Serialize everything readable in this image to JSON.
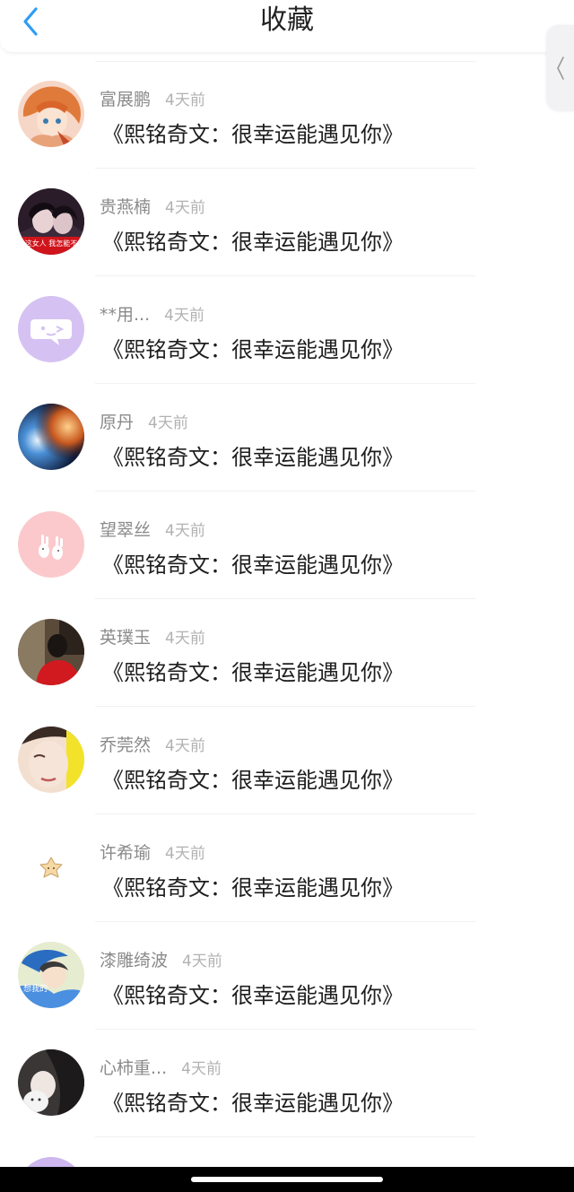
{
  "header": {
    "title": "收藏",
    "back_icon": "chevron-left-icon",
    "accent": "#2e9df5"
  },
  "side_tab": {
    "icon": "chevron-left-icon"
  },
  "items": [
    {
      "name": "富展鹏",
      "time": "4天前",
      "book": "《熙铭奇文：很幸运能遇见你》"
    },
    {
      "name": "贵燕楠",
      "time": "4天前",
      "book": "《熙铭奇文：很幸运能遇见你》",
      "avatar_caption": "这女人 我怎能不"
    },
    {
      "name": "**用...",
      "time": "4天前",
      "book": "《熙铭奇文：很幸运能遇见你》"
    },
    {
      "name": "原丹",
      "time": "4天前",
      "book": "《熙铭奇文：很幸运能遇见你》"
    },
    {
      "name": "望翠丝",
      "time": "4天前",
      "book": "《熙铭奇文：很幸运能遇见你》"
    },
    {
      "name": "英璞玉",
      "time": "4天前",
      "book": "《熙铭奇文：很幸运能遇见你》"
    },
    {
      "name": "乔莞然",
      "time": "4天前",
      "book": "《熙铭奇文：很幸运能遇见你》"
    },
    {
      "name": "许希瑜",
      "time": "4天前",
      "book": "《熙铭奇文：很幸运能遇见你》"
    },
    {
      "name": "漆雕绮波",
      "time": "4天前",
      "book": "《熙铭奇文：很幸运能遇见你》",
      "avatar_caption": "想我的"
    },
    {
      "name": "心柿重...",
      "time": "4天前",
      "book": "《熙铭奇文：很幸运能遇见你》"
    }
  ]
}
